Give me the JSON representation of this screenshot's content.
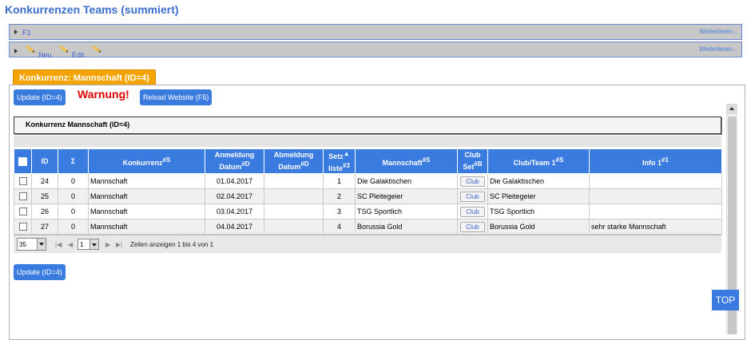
{
  "page": {
    "title": "Konkurrenzen Teams (summiert)"
  },
  "bars": {
    "f1": {
      "label": "F1",
      "more": "Weiterlesen..."
    },
    "actions": {
      "new_label": "Neu",
      "edit_label": "Edit",
      "more": "Weiterlesen..."
    }
  },
  "tab": {
    "label": "Konkurrenz: Mannschaft (ID=4)"
  },
  "toolbar": {
    "update_label": "Update (ID=4)",
    "warning": "Warnung!",
    "reload_label": "Reload Website (F5)"
  },
  "grid": {
    "caption": "Konkurrenz Mannschaft (ID=4)",
    "headers": {
      "id": "ID",
      "sigma": "Σ",
      "konkurrenz": "Konkurrenz",
      "konkurrenz_sup": "#S",
      "anmeldung_1": "Anmeldung",
      "anmeldung_2": "Datum",
      "anmeldung_sup": "#D",
      "abmeldung_1": "Abmeldung",
      "abmeldung_2": "Datum",
      "abmeldung_sup": "#D",
      "setz_1": "Setz",
      "setz_sort": "▲",
      "setz_2": "liste",
      "setz_sup": "#3",
      "mannschaft": "Mannschaft",
      "mannschaft_sup": "#S",
      "club_1": "Club",
      "club_2": "Set",
      "club_sup": "#B",
      "clubteam": "Club/Team 1",
      "clubteam_sup": "#S",
      "info": "Info 1",
      "info_sup": "#1"
    },
    "rows": [
      {
        "id": "24",
        "sigma": "0",
        "konkurrenz": "Mannschaft",
        "anmeldung": "01.04.2017",
        "abmeldung": "",
        "setz": "1",
        "mannschaft": "Die Galaktischen",
        "club": "Club",
        "clubteam": "Die Galaktischen",
        "info": ""
      },
      {
        "id": "25",
        "sigma": "0",
        "konkurrenz": "Mannschaft",
        "anmeldung": "02.04.2017",
        "abmeldung": "",
        "setz": "2",
        "mannschaft": "SC Pleitegeier",
        "club": "Club",
        "clubteam": "SC Pleitegeier",
        "info": ""
      },
      {
        "id": "26",
        "sigma": "0",
        "konkurrenz": "Mannschaft",
        "anmeldung": "03.04.2017",
        "abmeldung": "",
        "setz": "3",
        "mannschaft": "TSG Sportlich",
        "club": "Club",
        "clubteam": "TSG Sportlich",
        "info": ""
      },
      {
        "id": "27",
        "sigma": "0",
        "konkurrenz": "Mannschaft",
        "anmeldung": "04.04.2017",
        "abmeldung": "",
        "setz": "4",
        "mannschaft": "Borussia Gold",
        "club": "Club",
        "clubteam": "Borussia Gold",
        "info": "sehr starke Mannschaft"
      }
    ],
    "pager": {
      "page_size": "35",
      "page": "1",
      "status": "Zeilen anzeigen 1 bis 4 von 1"
    }
  },
  "footer": {
    "update_label": "Update (ID=4)",
    "top_label": "TOP"
  }
}
